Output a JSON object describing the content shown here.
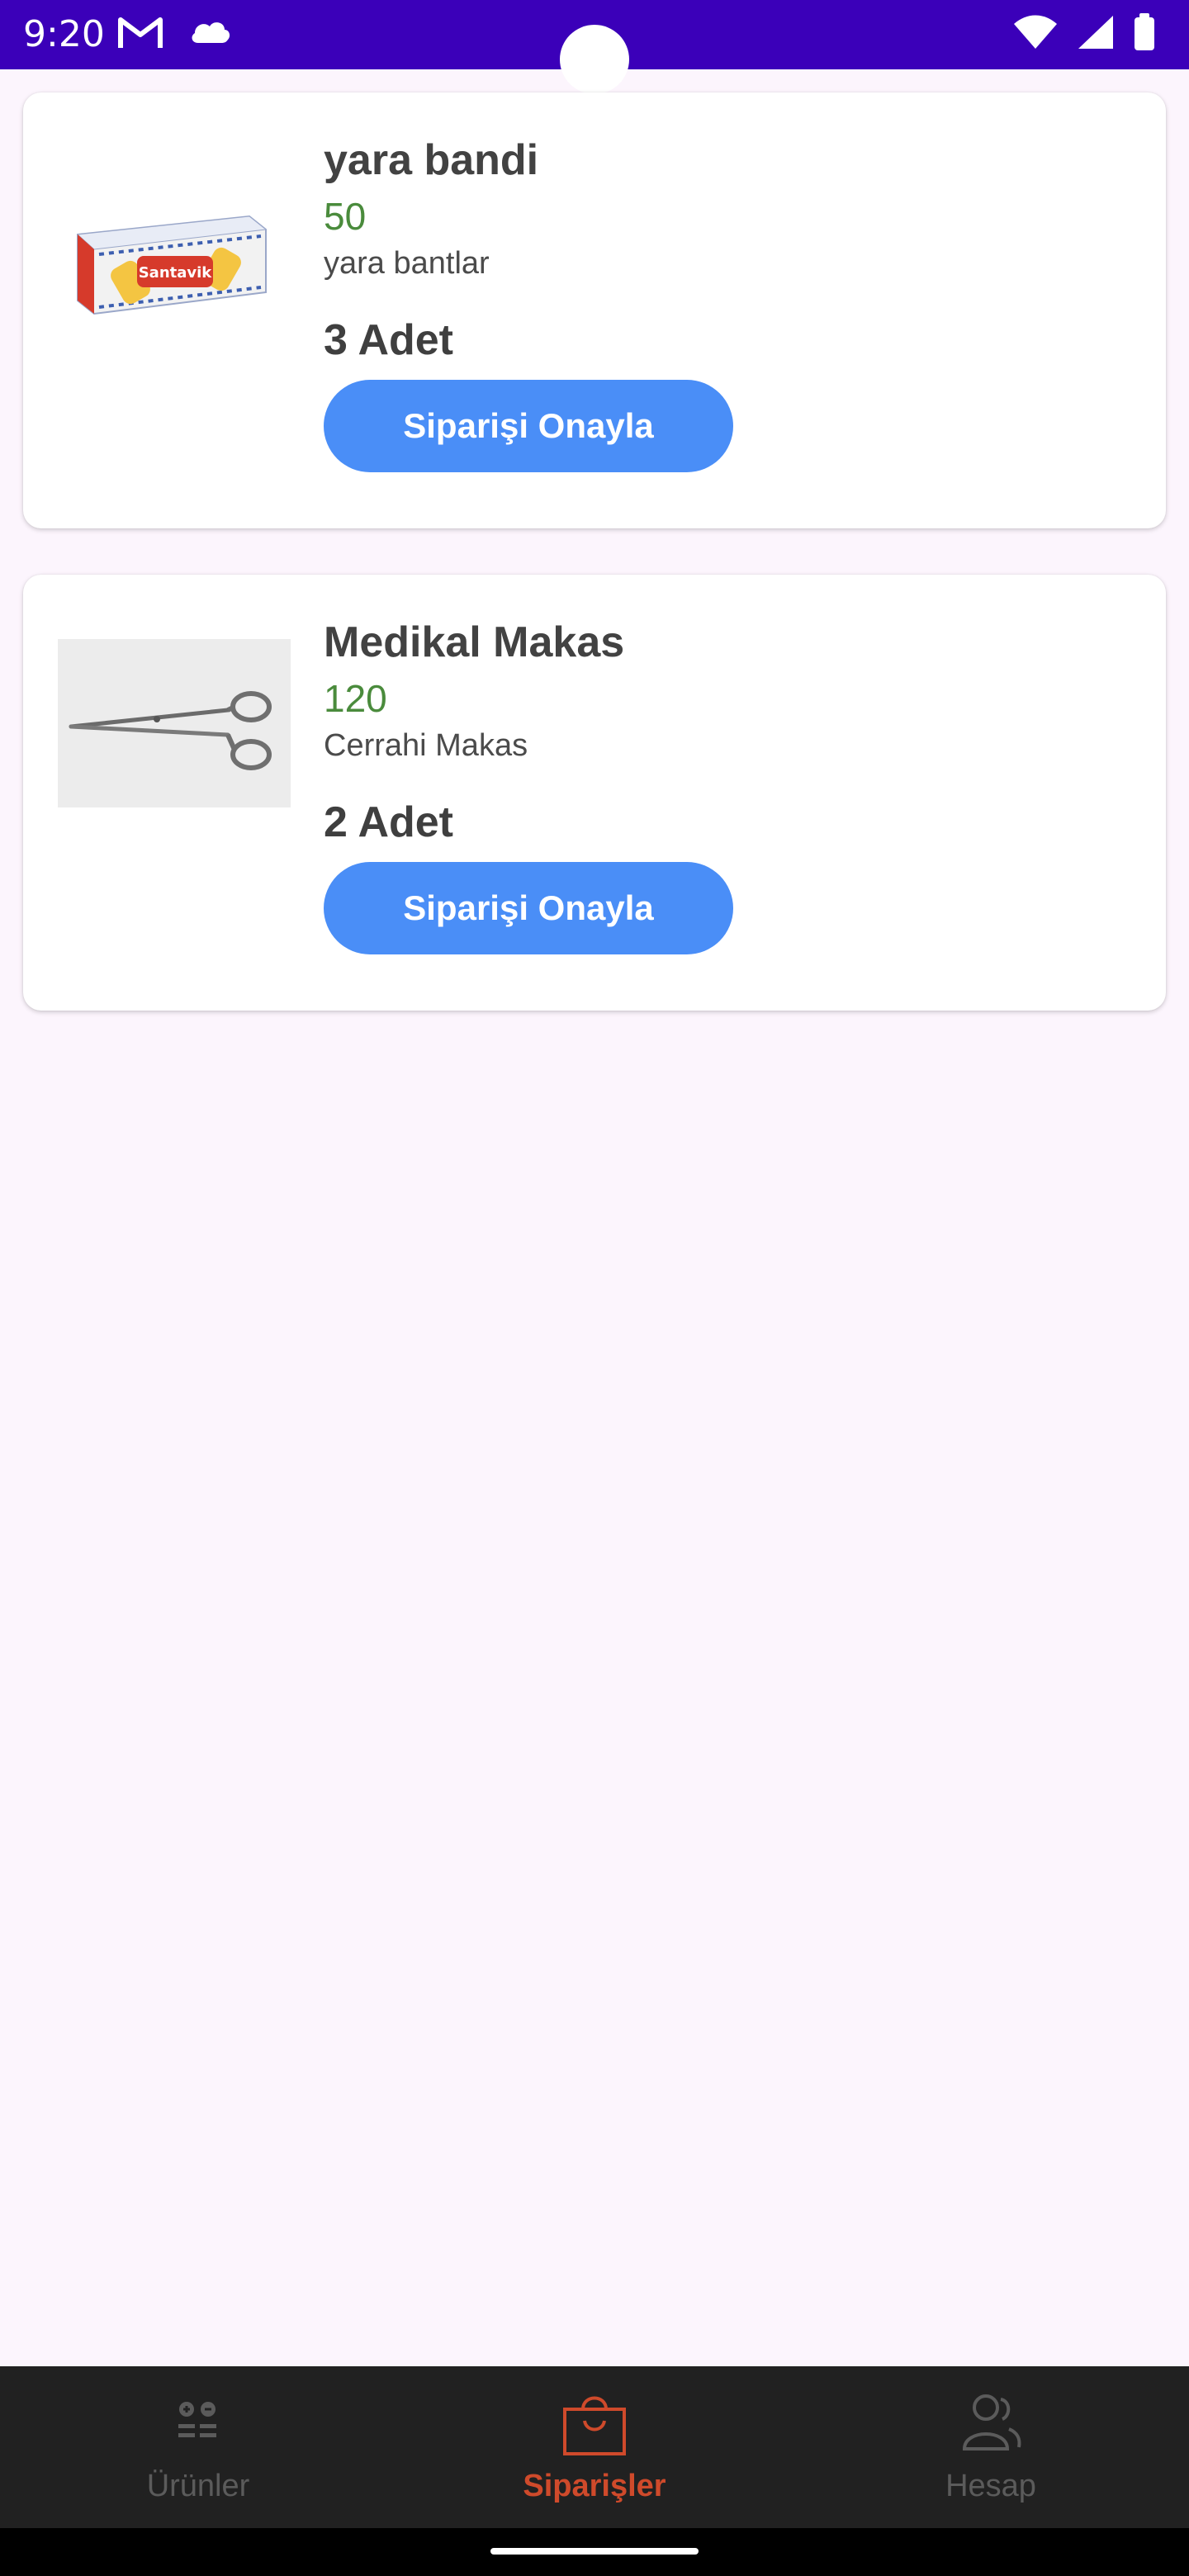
{
  "status_bar": {
    "time": "9:20",
    "left_icons": [
      "gmail-icon",
      "cloud-icon"
    ],
    "right_icons": [
      "wifi-icon",
      "cellular-signal-icon",
      "battery-icon"
    ],
    "background": "#3b00b9"
  },
  "orders": [
    {
      "name": "yara bandi",
      "price": "50",
      "description": "yara bantlar",
      "quantity": "3 Adet",
      "confirm_label": "Siparişi Onayla",
      "image_icon": "bandage-box-image",
      "image_brand_text": "Santavik"
    },
    {
      "name": "Medikal Makas",
      "price": "120",
      "description": "Cerrahi Makas",
      "quantity": "2 Adet",
      "confirm_label": "Siparişi Onayla",
      "image_icon": "surgical-scissors-image"
    }
  ],
  "bottom_nav": {
    "items": [
      {
        "label": "Ürünler",
        "icon": "products-icon",
        "active": false
      },
      {
        "label": "Siparişler",
        "icon": "shopping-bag-icon",
        "active": true
      },
      {
        "label": "Hesap",
        "icon": "account-icon",
        "active": false
      }
    ]
  },
  "colors": {
    "accent_button": "#4a8ef7",
    "price_green": "#4a8b3c",
    "nav_active": "#cf4a2b",
    "nav_inactive": "#5b5b5b",
    "page_background": "#fcf5fd"
  }
}
